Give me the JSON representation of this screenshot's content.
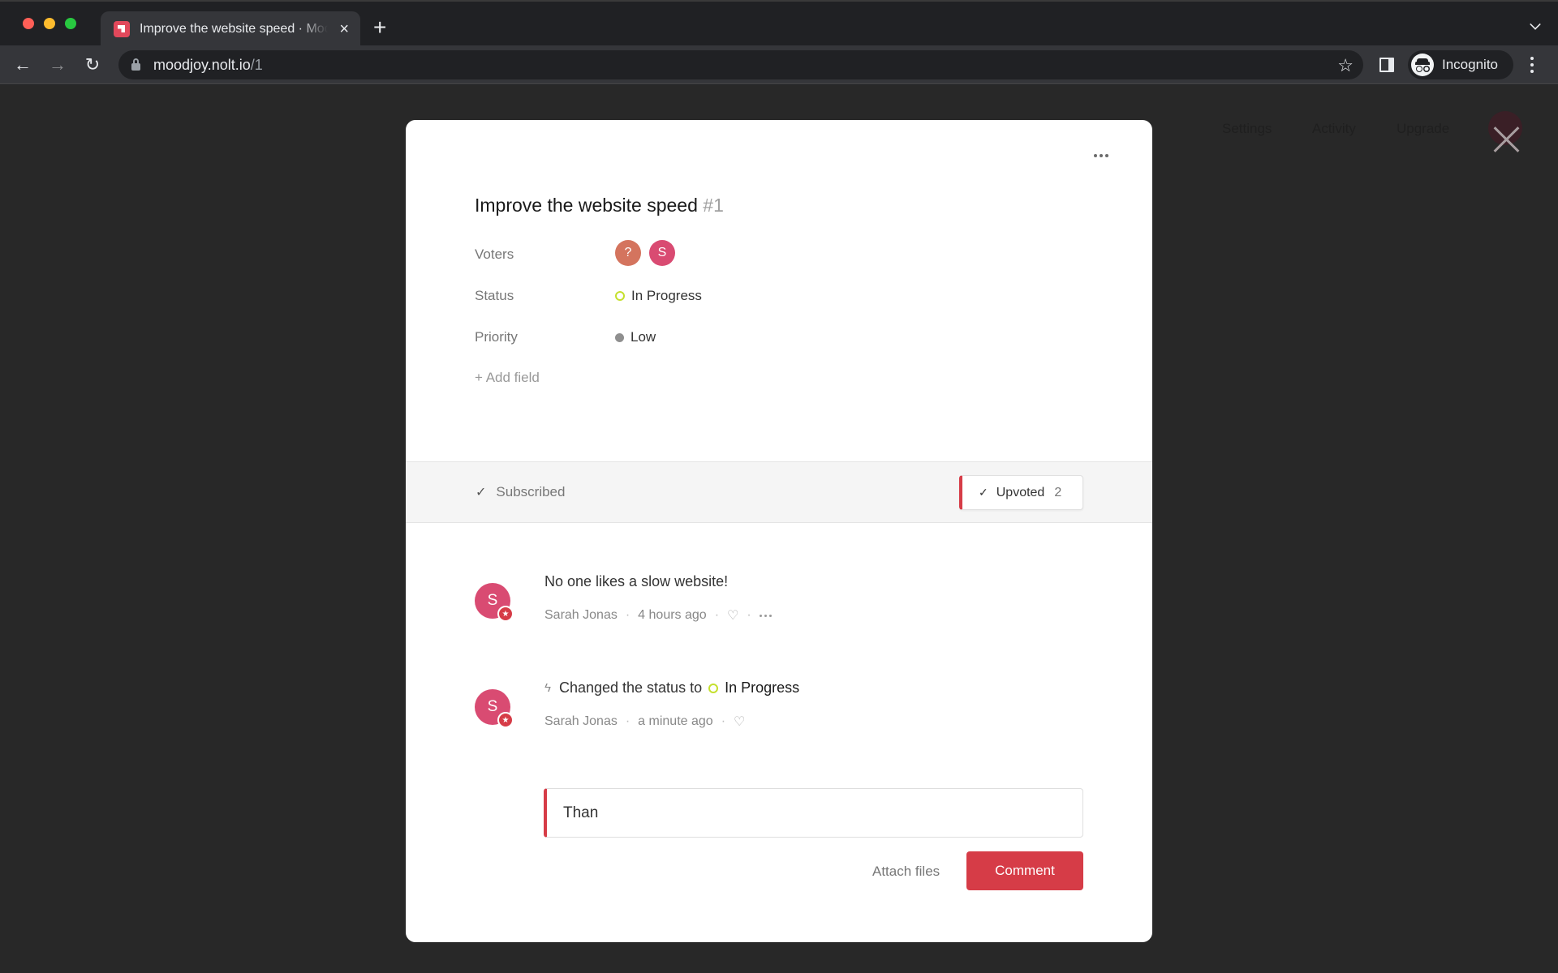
{
  "browser": {
    "tab": {
      "title": "Improve the website speed · Moodjoy",
      "favicon": "nolt-logo-icon",
      "close_icon": "×"
    },
    "new_tab_icon": "+",
    "url_host": "moodjoy.nolt.io",
    "url_path": "/1",
    "nav": {
      "back": "←",
      "forward": "→",
      "reload": "↻"
    },
    "bookmark_icon": "☆",
    "profile_label": "Incognito"
  },
  "background_nav": {
    "items": [
      "Settings",
      "Activity",
      "Upgrade"
    ]
  },
  "modal": {
    "title": "Improve the website speed",
    "number": "#1",
    "fields": {
      "voters_label": "Voters",
      "voters": [
        {
          "initial": "?",
          "color": "#d4745e"
        },
        {
          "initial": "S",
          "color": "#d94b72"
        }
      ],
      "status_label": "Status",
      "status_value": "In Progress",
      "status_color": "#c5e02e",
      "priority_label": "Priority",
      "priority_value": "Low",
      "priority_color": "#8f8f8f",
      "add_field": "+ Add field"
    },
    "actions": {
      "subscribed_check": "✓",
      "subscribed_label": "Subscribed",
      "upvote_check": "✓",
      "upvote_label": "Upvoted",
      "upvote_count": "2"
    },
    "comments": [
      {
        "avatar": "S",
        "body": "No one likes a slow website!",
        "author": "Sarah Jonas",
        "time": "4 hours ago",
        "like_icon": "♡"
      },
      {
        "avatar": "S",
        "activity_icon": "ϟ",
        "body_prefix": "Changed the status to",
        "status": "In Progress",
        "author": "Sarah Jonas",
        "time": "a minute ago",
        "like_icon": "♡"
      }
    ],
    "composer": {
      "value": "Than",
      "attach_label": "Attach files",
      "submit_label": "Comment"
    }
  },
  "colors": {
    "accent": "#d63c47",
    "status_in_progress": "#c5e02e"
  }
}
